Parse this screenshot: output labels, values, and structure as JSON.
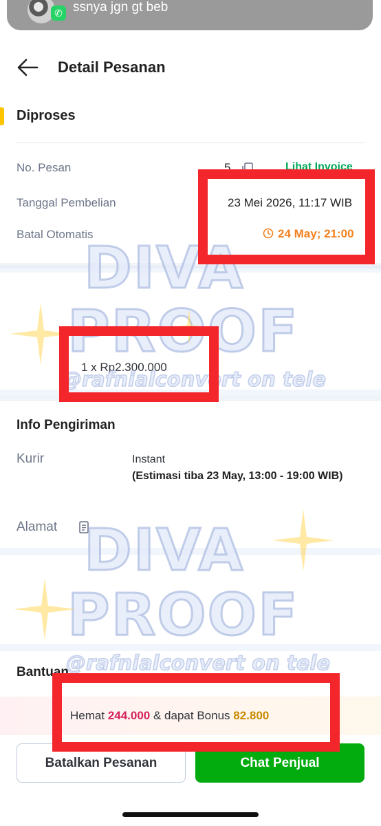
{
  "notification": {
    "text": "ssnya jgn gt beb",
    "app_icon": "whatsapp-icon"
  },
  "header": {
    "title": "Detail Pesanan",
    "back_icon": "arrow-left-icon"
  },
  "order": {
    "status": "Diproses",
    "no_pesan_label": "No. Pesan",
    "no_pesan_value": "5",
    "invoice_link": "Lihat Invoice",
    "tanggal_label": "Tanggal Pembelian",
    "tanggal_value": "23 Mei 2026, 11:17 WIB",
    "batal_label": "Batal Otomatis",
    "batal_value": "24 May; 21:00"
  },
  "product": {
    "price_line": "1 x Rp2.300.000"
  },
  "shipping": {
    "title": "Info Pengiriman",
    "kurir_label": "Kurir",
    "kurir_value": "Instant",
    "eta": "(Estimasi tiba 23 May, 13:00 - 19:00 WIB)",
    "alamat_label": "Alamat"
  },
  "help": {
    "title": "Bantuan"
  },
  "promo": {
    "hemat_label": "Hemat",
    "hemat_value": "244.000",
    "middle": "& dapat Bonus",
    "bonus_value": "82.800"
  },
  "actions": {
    "cancel_label": "Batalkan Pesanan",
    "chat_label": "Chat Penjual"
  },
  "watermark": {
    "line1": "DIVA",
    "line2": "PROOF",
    "handle": "@rafnialconvert on tele"
  },
  "colors": {
    "accent_green": "#03ac0e",
    "status_yellow": "#ffc400",
    "countdown_orange": "#f58220",
    "hemat_pink": "#d6225c",
    "bonus_gold": "#c88a00",
    "highlight_red": "#f2262b"
  }
}
